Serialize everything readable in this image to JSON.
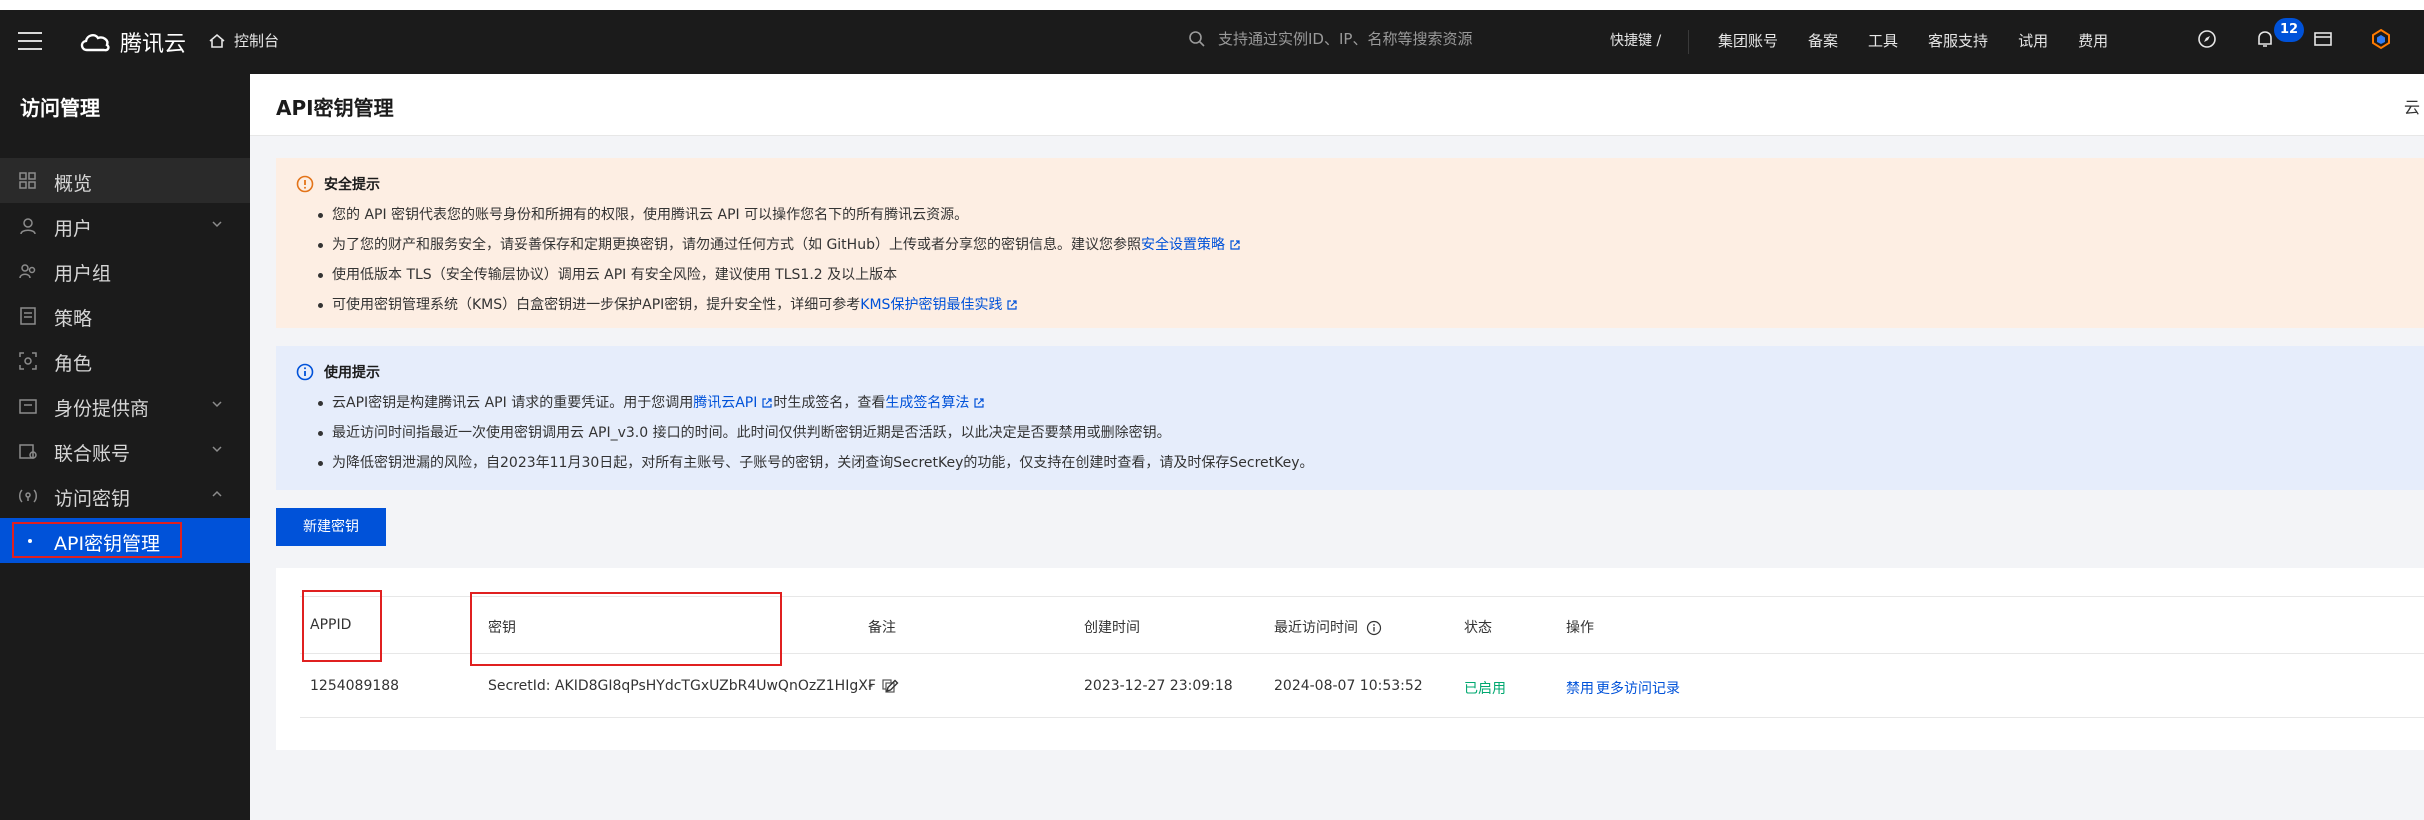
{
  "topbar": {
    "brand": "腾讯云",
    "console": "控制台",
    "search_placeholder": "支持通过实例ID、IP、名称等搜索资源",
    "shortcut": "快捷键 /",
    "links": [
      "集团账号",
      "备案",
      "工具",
      "客服支持",
      "试用",
      "费用"
    ],
    "notification_count": "12"
  },
  "sidebar": {
    "title": "访问管理",
    "items": [
      {
        "label": "概览",
        "icon": "grid-icon"
      },
      {
        "label": "用户",
        "icon": "user-icon"
      },
      {
        "label": "用户组",
        "icon": "user-group-icon"
      },
      {
        "label": "策略",
        "icon": "policy-icon"
      },
      {
        "label": "角色",
        "icon": "role-icon"
      },
      {
        "label": "身份提供商",
        "icon": "idp-icon"
      },
      {
        "label": "联合账号",
        "icon": "federated-account-icon"
      },
      {
        "label": "访问密钥",
        "icon": "key-icon"
      },
      {
        "label": "API密钥管理",
        "icon": ""
      }
    ]
  },
  "page": {
    "title": "API密钥管理",
    "right_text": "云"
  },
  "security_tip": {
    "heading": "安全提示",
    "line1": "您的 API 密钥代表您的账号身份和所拥有的权限，使用腾讯云 API 可以操作您名下的所有腾讯云资源。",
    "line2_pre": "为了您的财产和服务安全，请妥善保存和定期更换密钥，请勿通过任何方式（如 GitHub）上传或者分享您的密钥信息。建议您参照",
    "line2_link": "安全设置策略",
    "line3": "使用低版本 TLS（安全传输层协议）调用云 API 有安全风险，建议使用 TLS1.2 及以上版本",
    "line4_pre": "可使用密钥管理系统（KMS）白盒密钥进一步保护API密钥，提升安全性，详细可参考",
    "line4_link": "KMS保护密钥最佳实践"
  },
  "usage_tip": {
    "heading": "使用提示",
    "line1_pre": "云API密钥是构建腾讯云 API 请求的重要凭证。用于您调用",
    "line1_link1": "腾讯云API",
    "line1_mid": "时生成签名，查看",
    "line1_link2": "生成签名算法",
    "line2": "最近访问时间指最近一次使用密钥调用云 API_v3.0 接口的时间。此时间仅供判断密钥近期是否活跃，以此决定是否要禁用或删除密钥。",
    "line3": "为降低密钥泄漏的风险，自2023年11月30日起，对所有主账号、子账号的密钥，关闭查询SecretKey的功能，仅支持在创建时查看，请及时保存SecretKey。"
  },
  "new_key_button": "新建密钥",
  "table": {
    "headers": [
      "APPID",
      "密钥",
      "备注",
      "创建时间",
      "最近访问时间",
      "状态",
      "操作"
    ],
    "rows": [
      {
        "appid": "1254089188",
        "secret": "SecretId: AKID8GI8qPsHYdcTGxUZbR4UwQnOzZ1HIgXF",
        "remark": "-",
        "created": "2023-12-27 23:09:18",
        "last_access": "2024-08-07 10:53:52",
        "status": "已启用",
        "action_disable": "禁用",
        "action_more": "更多访问记录"
      }
    ]
  }
}
